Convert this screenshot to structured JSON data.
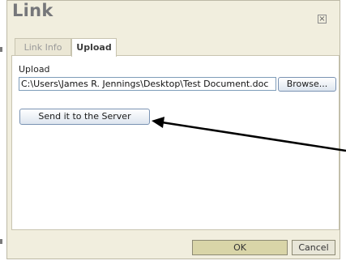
{
  "dialog": {
    "title": "Link",
    "close_icon": "close-icon"
  },
  "tabs": [
    {
      "label": "Link Info",
      "active": false
    },
    {
      "label": "Upload",
      "active": true
    }
  ],
  "upload": {
    "label": "Upload",
    "file_path": "C:\\Users\\James R. Jennings\\Desktop\\Test Document.doc",
    "browse_label": "Browse...",
    "send_label": "Send it to the Server"
  },
  "footer": {
    "ok_label": "OK",
    "cancel_label": "Cancel"
  },
  "annotation": {
    "arrow_color": "#000000"
  },
  "colors": {
    "dialog_bg": "#f1eede",
    "ok_button_bg": "#d9d5a8"
  }
}
